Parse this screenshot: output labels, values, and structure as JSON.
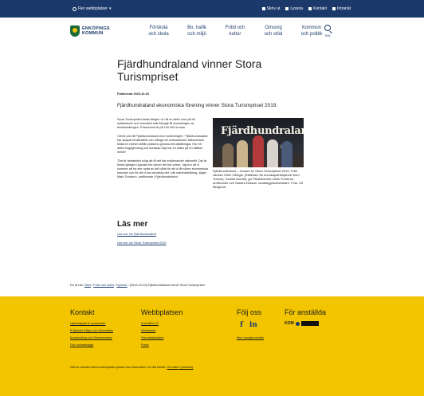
{
  "topbar": {
    "more_sites": "Fler webbplatser",
    "tools": [
      "Skriv ut",
      "Lyssna",
      "Kontakt",
      "Intranät"
    ]
  },
  "logo": {
    "line1": "ENKÖPINGS",
    "line2": "KOMMUN"
  },
  "nav": [
    {
      "line1": "Förskola",
      "line2": "och skola"
    },
    {
      "line1": "Bo, trafik",
      "line2": "och miljö"
    },
    {
      "line1": "Fritid och",
      "line2": "kultur"
    },
    {
      "line1": "Omsorg",
      "line2": "och stöd"
    },
    {
      "line1": "Kommun",
      "line2": "och politik"
    }
  ],
  "search_label": "Sök",
  "article": {
    "title": "Fjärdhundraland vinner Stora Turismpriset",
    "published": "Publicerad 2019-10-03",
    "lead": "Fjärdhundraland ekonomiska förening vinner Stora Turismpriset 2019.",
    "paragraphs": [
      "Stora Turismpriset delas årligen ut i till en aktör som på ett nytänkande och innovativt sätt bidragit till utvecklingen av besöksnäringen. Prissumma är på 100 000 kronan.",
      "I årets pris till Fjärdhundraland med motiveringen: \"Fjärdhundraland har skapat ett attraktivt och många vill verksamheter tillsammans bildat en helhet utifrån platsens genuina förutsättningar. Hur ett aktivt engagemang och kunskap vilja har en stabs på en hållbar helhet\"",
      "\"Det är fantastiskt roligt att få det här erkännandet nationellt. Det är första gången Uppsala län vinner det här priset. Jag tror att vi kommer att ha stor nytta av det både för att vi får större ekonomiska resurser och för att vi kan använda det i vår marknadsföring, säger Mats Thorburn, ordförande i Fjärdhundraland."
    ],
    "photo_text": "Fjärdhundraland",
    "photo_year": "2019",
    "caption": "Fjärdhundraland – vinnare av Stora Turismpriset 2019. Från vänster Helin Zillinger (Stiftelsen för kunskapsfrämjande inom Turism), Gunilla Nordlöf, gd Tillväxtverket, Mats Thorburn, ordförande och Sandra Nilsson, landsbygdsutvecklare. Foto: Ulf Berglund"
  },
  "read_more": {
    "heading": "Läs mer",
    "links": [
      "Läs mer om Fjärdhundraland",
      "Läs mer om Stora Turismpriset 2019"
    ]
  },
  "breadcrumb": {
    "prefix": "Du är här:",
    "items": [
      "Start",
      "Fritid och kultur",
      "Nyheter"
    ],
    "current": "(2019-10-03) Fjärdhundraland vinner Stora Turismpriset"
  },
  "footer": {
    "kontakt": {
      "heading": "Kontakt",
      "links": [
        "Hjärnsläppet & synpunkter",
        "E-tjänster frågor och felanmälan",
        "Kommunhus och Servicecenter",
        "Fler kontaktvägar"
      ]
    },
    "webbplatsen": {
      "heading": "Webbplatsen",
      "links": [
        "Innehåll A–Ö",
        "Webbkarta",
        "Om webbplatsen",
        "Press"
      ]
    },
    "folj": {
      "heading": "Följ oss",
      "link": "Mer i sociala medier"
    },
    "anstallda": {
      "heading": "För anställda",
      "kom_label": "KOM"
    },
    "cookie_text": "När du besöker denna webbplats sparas viss information om ditt besök.",
    "cookie_link": "Om kakor (cookies)",
    "cookie_end": "."
  }
}
